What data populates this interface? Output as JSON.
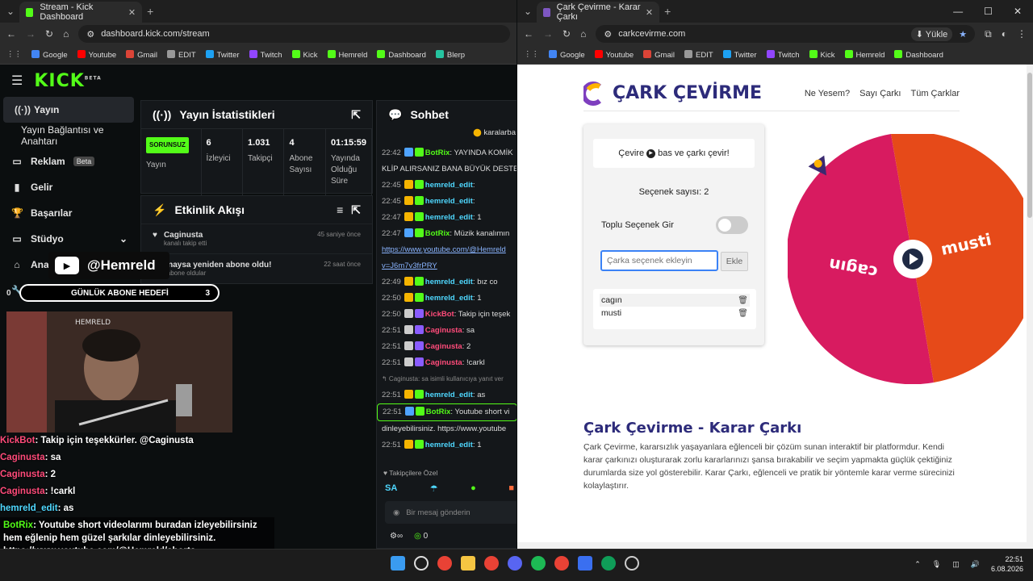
{
  "left_window": {
    "tab_title": "Stream - Kick Dashboard",
    "url": "dashboard.kick.com/stream",
    "bookmarks": [
      "Google",
      "Youtube",
      "Gmail",
      "EDIT",
      "Twitter",
      "Twitch",
      "Kick",
      "Hemreld",
      "Dashboard",
      "Blerp"
    ],
    "logo": "KICK",
    "logo_sup": "BETA",
    "sidebar": [
      {
        "label": "Yayın",
        "icon": "broadcast-icon"
      },
      {
        "label": "Yayın Bağlantısı ve Anahtarı",
        "icon": ""
      },
      {
        "label": "Reklam",
        "icon": "ad-icon",
        "badge": "Beta"
      },
      {
        "label": "Gelir",
        "icon": "chart-icon"
      },
      {
        "label": "Başarılar",
        "icon": "trophy-icon"
      },
      {
        "label": "Stüdyo",
        "icon": "studio-icon"
      },
      {
        "label": "Ana",
        "icon": "analytics-icon"
      },
      {
        "label": "Denetlem",
        "icon": "wrench-icon"
      }
    ],
    "stats_panel": {
      "title": "Yayın İstatistikleri",
      "badge": "SORUNSUZ",
      "items": [
        {
          "value": "",
          "label": "Yayın"
        },
        {
          "value": "6",
          "label": "İzleyici"
        },
        {
          "value": "1.031",
          "label": "Takipçi"
        },
        {
          "value": "4",
          "label": "Abone Sayısı"
        },
        {
          "value": "01:15:59",
          "label": "Yayında Olduğu Süre"
        }
      ]
    },
    "activity_panel": {
      "title": "Etkinlik Akışı",
      "rows": [
        {
          "name": "Caginusta",
          "sub": "kanalı takip etti",
          "time": "45 saniye önce"
        },
        {
          "name": "sanaysa yeniden abone oldu!",
          "sub": "lik abone oldular",
          "time": "22 saat önce"
        }
      ]
    },
    "chat_panel": {
      "title": "Sohbet",
      "pinned_user": "karalarba",
      "lines": [
        {
          "time": "22:42",
          "user": "BotRix",
          "cls": "u1",
          "text": ": YAYINDA KOMİK"
        },
        {
          "time": "",
          "user": "",
          "cls": "",
          "text": "KLİP ALIRSANIZ BANA BÜYÜK DESTE"
        },
        {
          "time": "22:45",
          "user": "hemreld_edit",
          "cls": "u3",
          "text": ":"
        },
        {
          "time": "22:45",
          "user": "hemreld_edit",
          "cls": "u3",
          "text": ":"
        },
        {
          "time": "22:47",
          "user": "hemreld_edit",
          "cls": "u3",
          "text": ": 1"
        },
        {
          "time": "22:47",
          "user": "BotRix",
          "cls": "u1",
          "text": ": Müzik kanalımın"
        },
        {
          "time": "",
          "user": "",
          "cls": "lnk",
          "text": "https://www.youtube.com/@Hemreld"
        },
        {
          "time": "",
          "user": "",
          "cls": "lnk",
          "text": "v=J6m7v3frPRY"
        },
        {
          "time": "22:49",
          "user": "hemreld_edit",
          "cls": "u3",
          "text": ": bız co"
        },
        {
          "time": "22:50",
          "user": "hemreld_edit",
          "cls": "u3",
          "text": ": 1"
        },
        {
          "time": "22:50",
          "user": "KickBot",
          "cls": "u2",
          "text": ": Takip için teşek"
        },
        {
          "time": "22:51",
          "user": "Caginusta",
          "cls": "u2",
          "text": ": sa"
        },
        {
          "time": "22:51",
          "user": "Caginusta",
          "cls": "u2",
          "text": ": 2"
        },
        {
          "time": "22:51",
          "user": "Caginusta",
          "cls": "u2",
          "text": ": !carkl"
        },
        {
          "time": "",
          "user": "",
          "cls": "note",
          "text": "Caginusta: sa isimli kullanıcıya yanıt ver"
        },
        {
          "time": "22:51",
          "user": "hemreld_edit",
          "cls": "u3",
          "text": ": as"
        },
        {
          "time": "22:51",
          "user": "BotRix",
          "cls": "u1",
          "text": ": Youtube short vi"
        },
        {
          "time": "",
          "user": "",
          "cls": "",
          "text": "dinleyebilirsiniz. https://www.youtube"
        },
        {
          "time": "22:51",
          "user": "hemreld_edit",
          "cls": "u3",
          "text": ": 1"
        }
      ],
      "followers_only": "Takipçilere Özel",
      "emote_label": "SA",
      "input_placeholder": "Bir mesaj gönderin",
      "points": "0"
    },
    "overlay": {
      "channel": "@Hemreld",
      "goal_label": "GÜNLÜK ABONE HEDEFİ",
      "goal_left": "0",
      "goal_value": "3",
      "cam_label": "HEMRELD",
      "chat": [
        {
          "user": "KickBot",
          "text": ": Takip için teşekkürler. @Caginusta",
          "cls": "u2"
        },
        {
          "user": "Caginusta",
          "text": ": sa",
          "cls": "u2"
        },
        {
          "user": "Caginusta",
          "text": ": 2",
          "cls": "u2"
        },
        {
          "user": "Caginusta",
          "text": ": !carkl",
          "cls": "u2"
        },
        {
          "user": "hemreld_edit",
          "text": ": as",
          "cls": "u3"
        },
        {
          "user": "BotRix",
          "text": ": Youtube short videolarımı buradan izleyebilirsiniz hem eğlenip hem güzel şarkılar dinleyebilirsiniz. https://www.youtube.com/@Hemreld/shorts",
          "cls": "u1"
        },
        {
          "user": "hemreld_edit",
          "text": ": 1",
          "cls": "u3"
        }
      ]
    }
  },
  "right_window": {
    "tab_title": "Çark Çevirme - Karar Çarkı",
    "url": "carkcevirme.com",
    "install_label": "Yükle",
    "bookmarks": [
      "Google",
      "Youtube",
      "Gmail",
      "EDIT",
      "Twitter",
      "Twitch",
      "Kick",
      "Hemreld",
      "Dashboard"
    ],
    "site": {
      "logo_text": "ÇARK ÇEVİRME",
      "nav": [
        "Ne Yesem?",
        "Sayı Çarkı",
        "Tüm Çarklar"
      ],
      "hint_before": "Çevire",
      "hint_after": "bas ve çarkı çevir!",
      "option_count": "Seçenek sayısı: 2",
      "bulk_label": "Toplu Seçenek Gir",
      "input_placeholder": "Çarka seçenek ekleyin",
      "add_button": "Ekle",
      "options": [
        "cagın",
        "musti"
      ],
      "wheel_labels": [
        "cagın",
        "musti"
      ],
      "wheel_colors": [
        "#d81b60",
        "#e64a19"
      ],
      "heading": "Çark Çevirme - Karar Çarkı",
      "paragraph": "Çark Çevirme, kararsızlık yaşayanlara eğlenceli bir çözüm sunan interaktif bir platformdur. Kendi karar çarkınızı oluşturarak zorlu kararlarınızı şansa bırakabilir ve seçim yapmakta güçlük çektiğiniz durumlarda size yol gösterebilir. Karar Çarkı, eğlenceli ve pratik bir yöntemle karar verme sürecinizi kolaylaştırır."
    }
  },
  "taskbar": {
    "time": "22:51",
    "date": "6.08.2026"
  }
}
